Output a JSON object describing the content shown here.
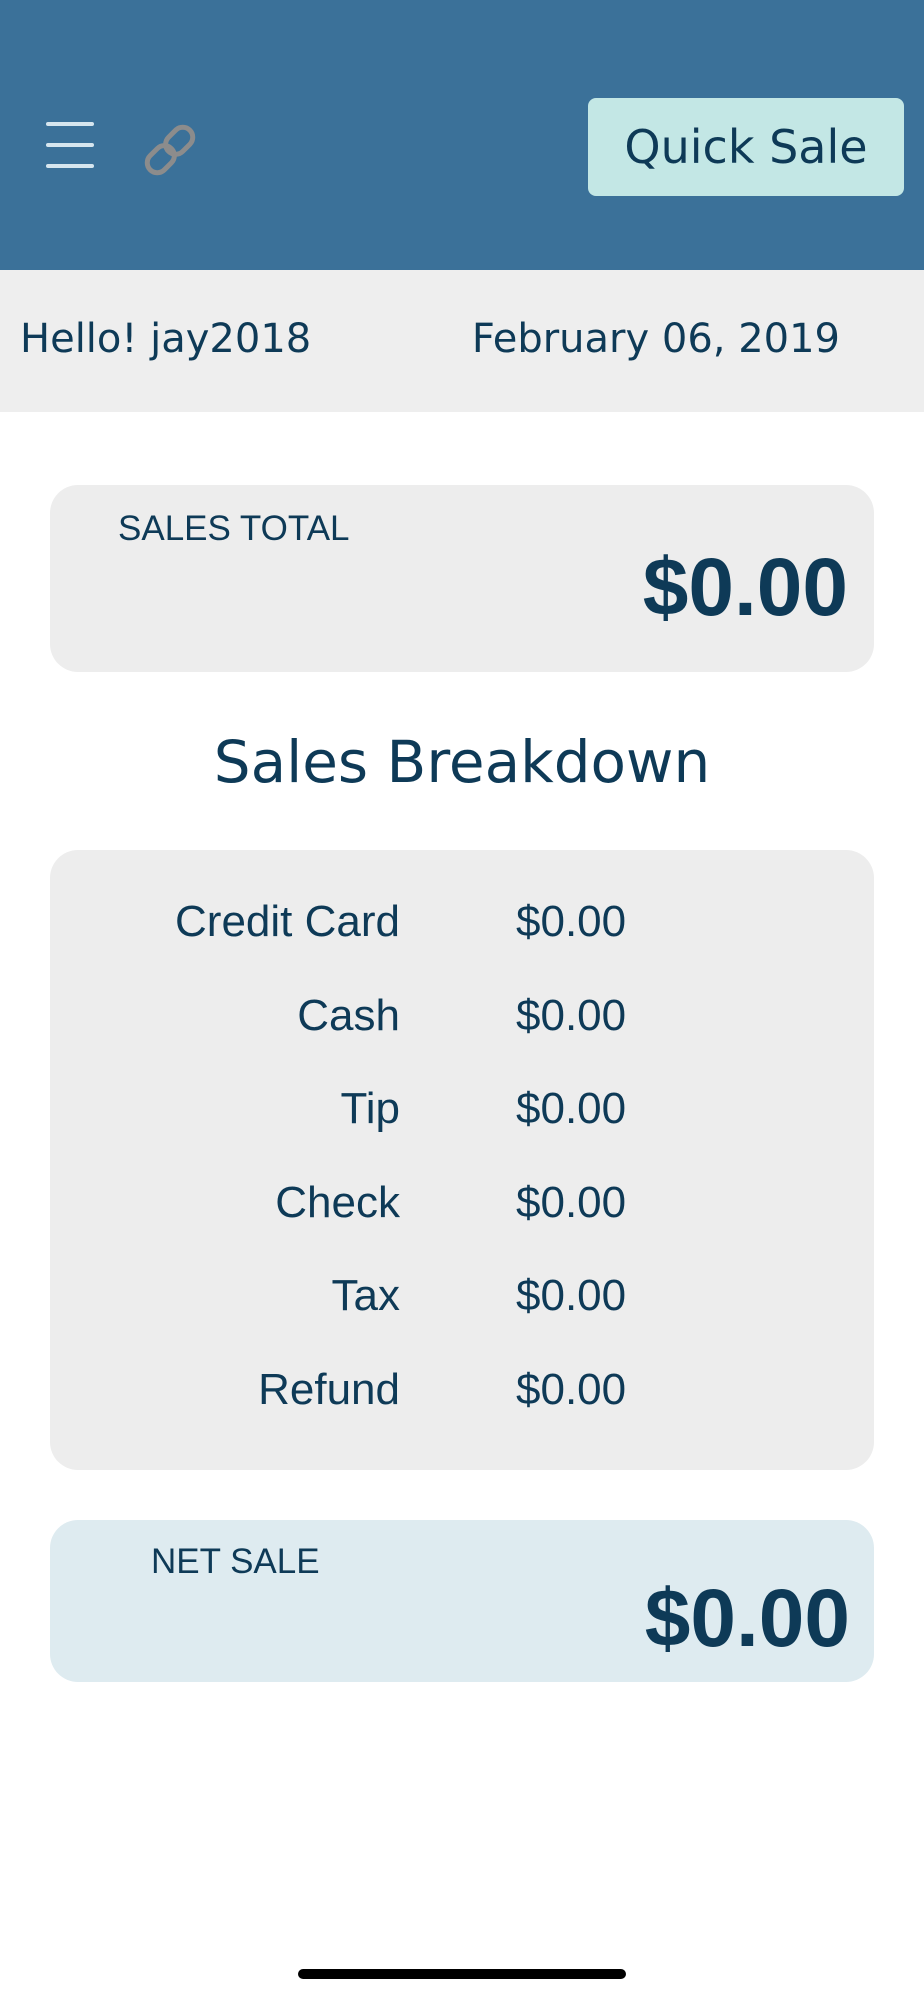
{
  "header": {
    "menu_icon": "hamburger-menu-icon",
    "link_icon": "link-icon",
    "quick_sale_label": "Quick Sale",
    "background_color": "#3b7199",
    "button_color": "#c3e7e5"
  },
  "greeting_bar": {
    "greeting": "Hello! jay2018",
    "date": "February 06, 2019"
  },
  "sales_total": {
    "label": "SALES TOTAL",
    "amount": "$0.00"
  },
  "breakdown": {
    "title": "Sales Breakdown",
    "rows": [
      {
        "label": "Credit Card",
        "value": "$0.00"
      },
      {
        "label": "Cash",
        "value": "$0.00"
      },
      {
        "label": "Tip",
        "value": "$0.00"
      },
      {
        "label": "Check",
        "value": "$0.00"
      },
      {
        "label": "Tax",
        "value": "$0.00"
      },
      {
        "label": "Refund",
        "value": "$0.00"
      }
    ]
  },
  "net_sale": {
    "label": "NET SALE",
    "amount": "$0.00"
  }
}
